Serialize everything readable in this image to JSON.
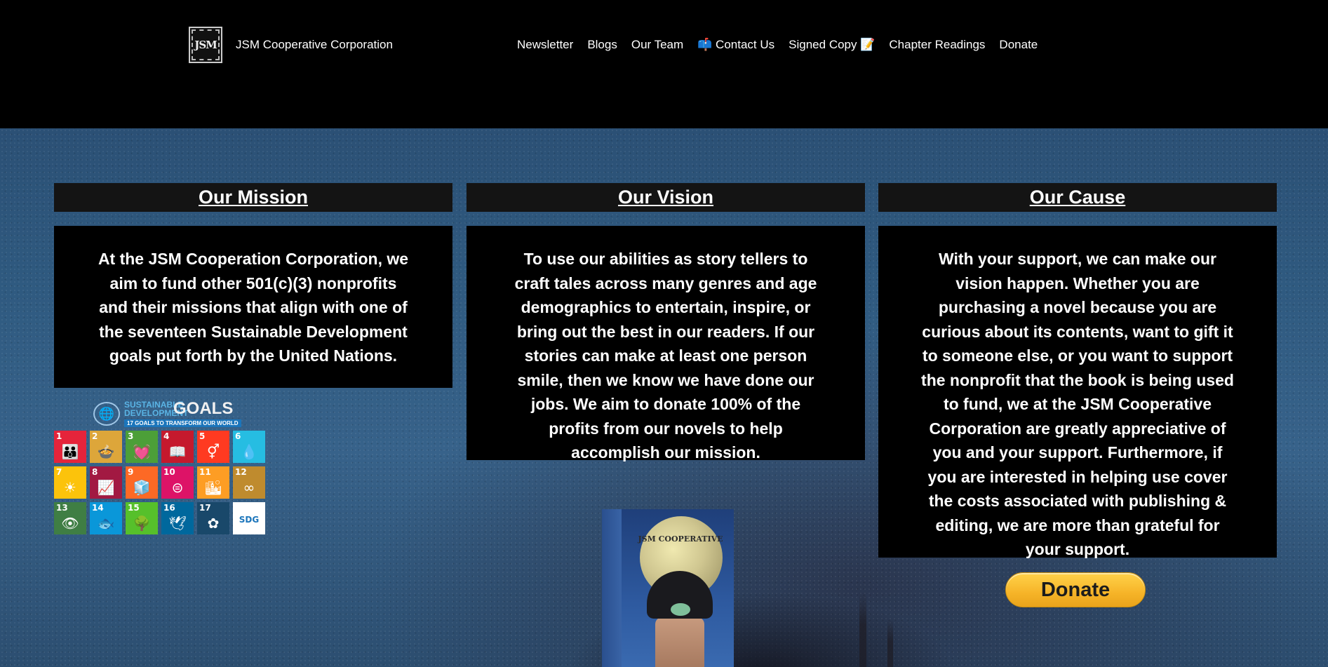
{
  "header": {
    "logo_text": "JSM",
    "brand": "JSM Cooperative Corporation",
    "nav": [
      {
        "label": "Newsletter"
      },
      {
        "label": "Blogs"
      },
      {
        "label": "Our Team"
      },
      {
        "label": "📫 Contact Us"
      },
      {
        "label": "Signed Copy 📝"
      },
      {
        "label": "Chapter Readings"
      },
      {
        "label": "Donate"
      }
    ]
  },
  "columns": [
    {
      "title": "Our Mission",
      "text": "At the JSM Cooperation Corporation, we aim to fund other 501(c)(3) nonprofits and their missions that align with one of the seventeen Sustainable Development goals put forth by the United Nations."
    },
    {
      "title": "Our Vision",
      "text": "To use our abilities as story tellers to craft tales across many genres and age demographics to entertain, inspire, or bring out the best in our readers. If our stories can make at least one person smile, then we know we have done our jobs. We aim to donate 100% of the profits from our novels to help accomplish our mission."
    },
    {
      "title": "Our Cause",
      "text": "With your support, we can make our vision happen. Whether you are purchasing a novel because you are curious about its contents, want to gift it to someone else, or you want to support the nonprofit that the book is being used to fund, we at the JSM Cooperative Corporation are greatly appreciative of you and your support. Furthermore, if you are interested in helping use cover the costs associated with publishing & editing, we are more than grateful for your support."
    }
  ],
  "sdg": {
    "title_line1": "SUSTAINABLE",
    "title_line2": "DEVELOPMENT",
    "goals_word": "GOALS",
    "tagline": "17 GOALS TO TRANSFORM OUR WORLD",
    "tiles": [
      {
        "num": "1",
        "color": "#e5243b",
        "icon": "👪"
      },
      {
        "num": "2",
        "color": "#dda63a",
        "icon": "🍲"
      },
      {
        "num": "3",
        "color": "#4c9f38",
        "icon": "💓"
      },
      {
        "num": "4",
        "color": "#c5192d",
        "icon": "📖"
      },
      {
        "num": "5",
        "color": "#ff3a21",
        "icon": "⚥"
      },
      {
        "num": "6",
        "color": "#26bde2",
        "icon": "💧"
      },
      {
        "num": "7",
        "color": "#fcc30b",
        "icon": "☀"
      },
      {
        "num": "8",
        "color": "#a21942",
        "icon": "📈"
      },
      {
        "num": "9",
        "color": "#fd6925",
        "icon": "🧊"
      },
      {
        "num": "10",
        "color": "#dd1367",
        "icon": "⊜"
      },
      {
        "num": "11",
        "color": "#fd9d24",
        "icon": "🏙"
      },
      {
        "num": "12",
        "color": "#bf8b2e",
        "icon": "∞"
      },
      {
        "num": "13",
        "color": "#3f7e44",
        "icon": "👁"
      },
      {
        "num": "14",
        "color": "#0a97d9",
        "icon": "🐟"
      },
      {
        "num": "15",
        "color": "#56c02b",
        "icon": "🌳"
      },
      {
        "num": "16",
        "color": "#00689d",
        "icon": "🕊"
      },
      {
        "num": "17",
        "color": "#19486a",
        "icon": "✿"
      },
      {
        "num": "",
        "color": "#ffffff",
        "icon": "SDG"
      }
    ]
  },
  "book": {
    "title": "JSM COOPERATIVE"
  },
  "donate": {
    "label": "Donate"
  }
}
